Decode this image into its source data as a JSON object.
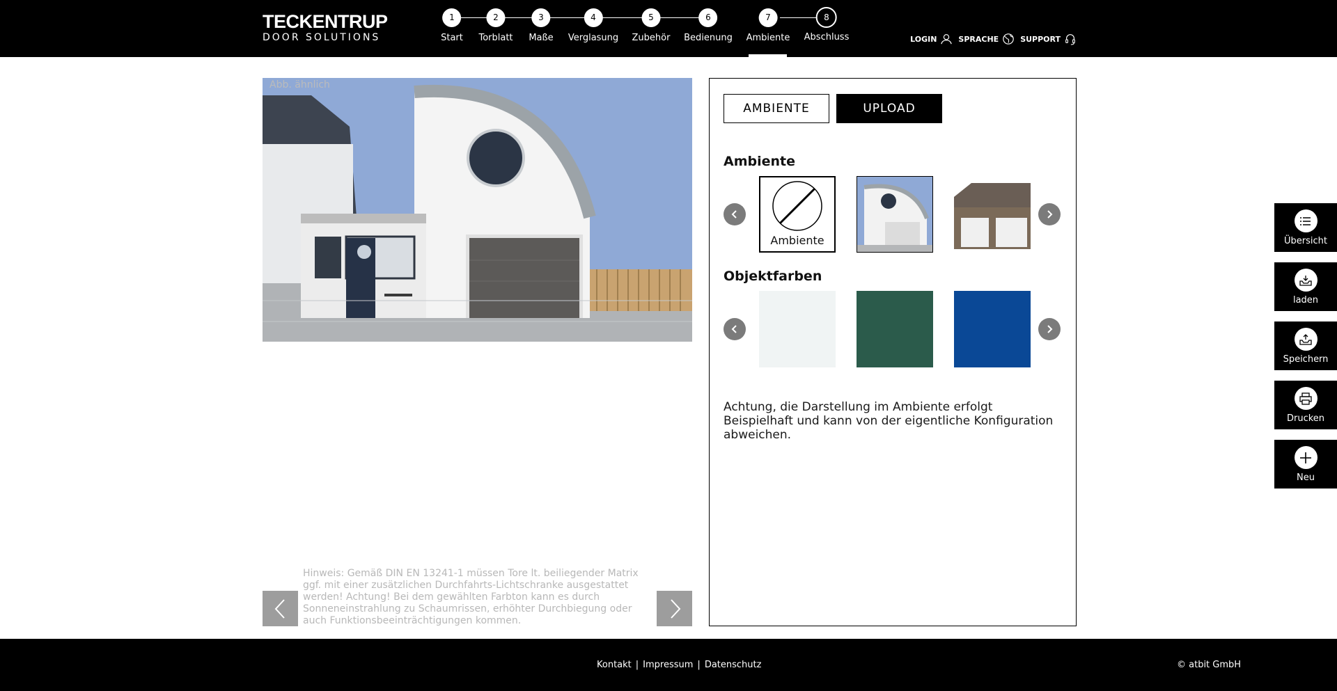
{
  "brand": {
    "line1": "TECKENTRUP",
    "line2": "DOOR SOLUTIONS"
  },
  "steps": [
    {
      "num": "1",
      "label": "Start"
    },
    {
      "num": "2",
      "label": "Torblatt"
    },
    {
      "num": "3",
      "label": "Maße"
    },
    {
      "num": "4",
      "label": "Verglasung"
    },
    {
      "num": "5",
      "label": "Zubehör"
    },
    {
      "num": "6",
      "label": "Bedienung"
    },
    {
      "num": "7",
      "label": "Ambiente"
    },
    {
      "num": "8",
      "label": "Abschluss"
    }
  ],
  "active_step": "7",
  "topnav": {
    "login": "LOGIN",
    "language": "SPRACHE",
    "support": "SUPPORT"
  },
  "preview": {
    "caption": "Abb. ähnlich",
    "notice": "Hinweis: Gemäß DIN EN 13241-1 müssen Tore lt. beiliegender Matrix ggf. mit einer zusätzlichen Durchfahrts-Lichtschranke ausgestattet werden! Achtung! Bei dem gewählten Farbton kann es durch Sonneneinstrahlung zu Schaumrissen, erhöhter Durchbiegung oder auch Funktionsbeeinträchtigungen kommen."
  },
  "panel": {
    "tab_ambiente": "AMBIENTE",
    "tab_upload": "UPLOAD",
    "section_ambiente": "Ambiente",
    "none_label": "Ambiente",
    "section_colors": "Objektfarben",
    "hint": "Achtung, die Darstellung im Ambiente erfolgt Beispielhaft und kann von der eigentliche Konfiguration abweichen."
  },
  "object_colors": [
    "#f0f4f4",
    "#2b5b4b",
    "#0a4896"
  ],
  "sidebar": {
    "overview": "Übersicht",
    "load": "laden",
    "save": "Speichern",
    "print": "Drucken",
    "new": "Neu"
  },
  "footer": {
    "contact": "Kontakt",
    "imprint": "Impressum",
    "privacy": "Datenschutz",
    "sep": "|",
    "copyright": "© atbit GmbH"
  }
}
